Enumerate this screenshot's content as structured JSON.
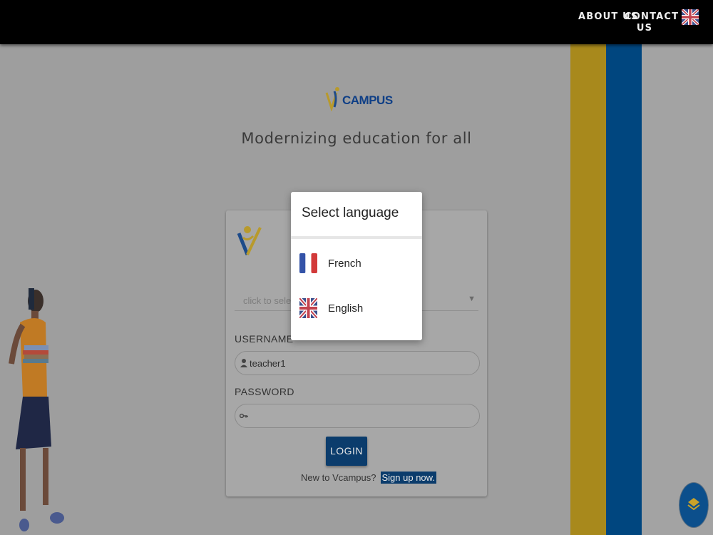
{
  "nav": {
    "about_label": "ABOUT US",
    "contact_line1": "CONTACT",
    "contact_line2": "US",
    "language_flag_icon": "uk-flag-icon"
  },
  "brand": {
    "logo_text": "CAMPUS",
    "tagline": "Modernizing education for all"
  },
  "login": {
    "language_select_placeholder": "click to select a",
    "username_label": "USERNAME",
    "username_value": "teacher1",
    "password_label": "PASSWORD",
    "password_value": "",
    "login_button": "LOGIN",
    "new_user_text": "New to Vcampus?",
    "signup_link": "Sign up now."
  },
  "dialog": {
    "title": "Select language",
    "options": [
      {
        "label": "French",
        "icon": "france-flag-icon"
      },
      {
        "label": "English",
        "icon": "uk-flag-icon"
      }
    ]
  },
  "colors": {
    "stripe_yellow": "#a8891c",
    "stripe_blue": "#00467f",
    "button_blue": "#0b3c6c",
    "fab_blue": "#0c4f8c"
  }
}
